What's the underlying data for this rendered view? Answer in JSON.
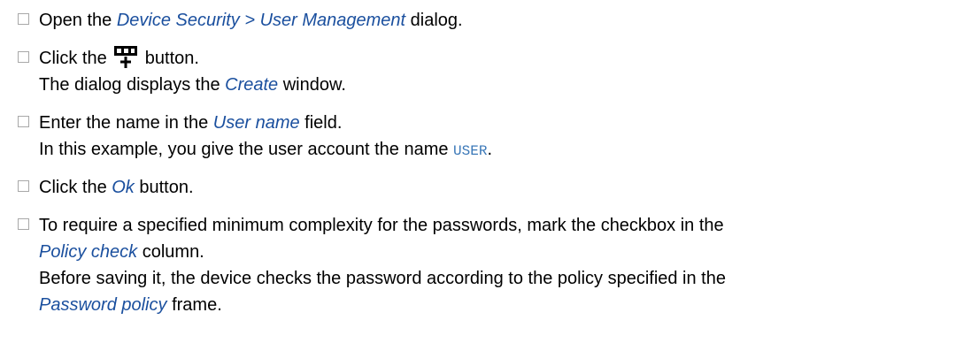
{
  "steps": [
    {
      "lines": [
        {
          "a": "Open the ",
          "em": "Device Security > User Management",
          "b": " dialog."
        }
      ]
    },
    {
      "lines": [
        {
          "a": "Click the ",
          "icon": "add-table-row-icon",
          "b": " button."
        },
        {
          "a": "The dialog displays the ",
          "em": "Create",
          "b": " window."
        }
      ]
    },
    {
      "lines": [
        {
          "a": "Enter the name in the ",
          "em": "User name",
          "b": " field."
        },
        {
          "a": "In this example, you give the user account the name ",
          "code": "USER",
          "b": "."
        }
      ]
    },
    {
      "lines": [
        {
          "a": "Click the ",
          "em": "Ok",
          "b": " button."
        }
      ]
    },
    {
      "lines": [
        {
          "a": "To require a specified minimum complexity for the passwords, mark the checkbox in the"
        },
        {
          "em": "Policy check",
          "b": " column."
        },
        {
          "a": "Before saving it, the device checks the password according to the policy specified in the"
        },
        {
          "em": "Password policy",
          "b": " frame."
        }
      ]
    }
  ],
  "colors": {
    "emphasis": "#1a4f9e",
    "code": "#3b78b8",
    "checkbox_border": "#a8a8a8"
  }
}
